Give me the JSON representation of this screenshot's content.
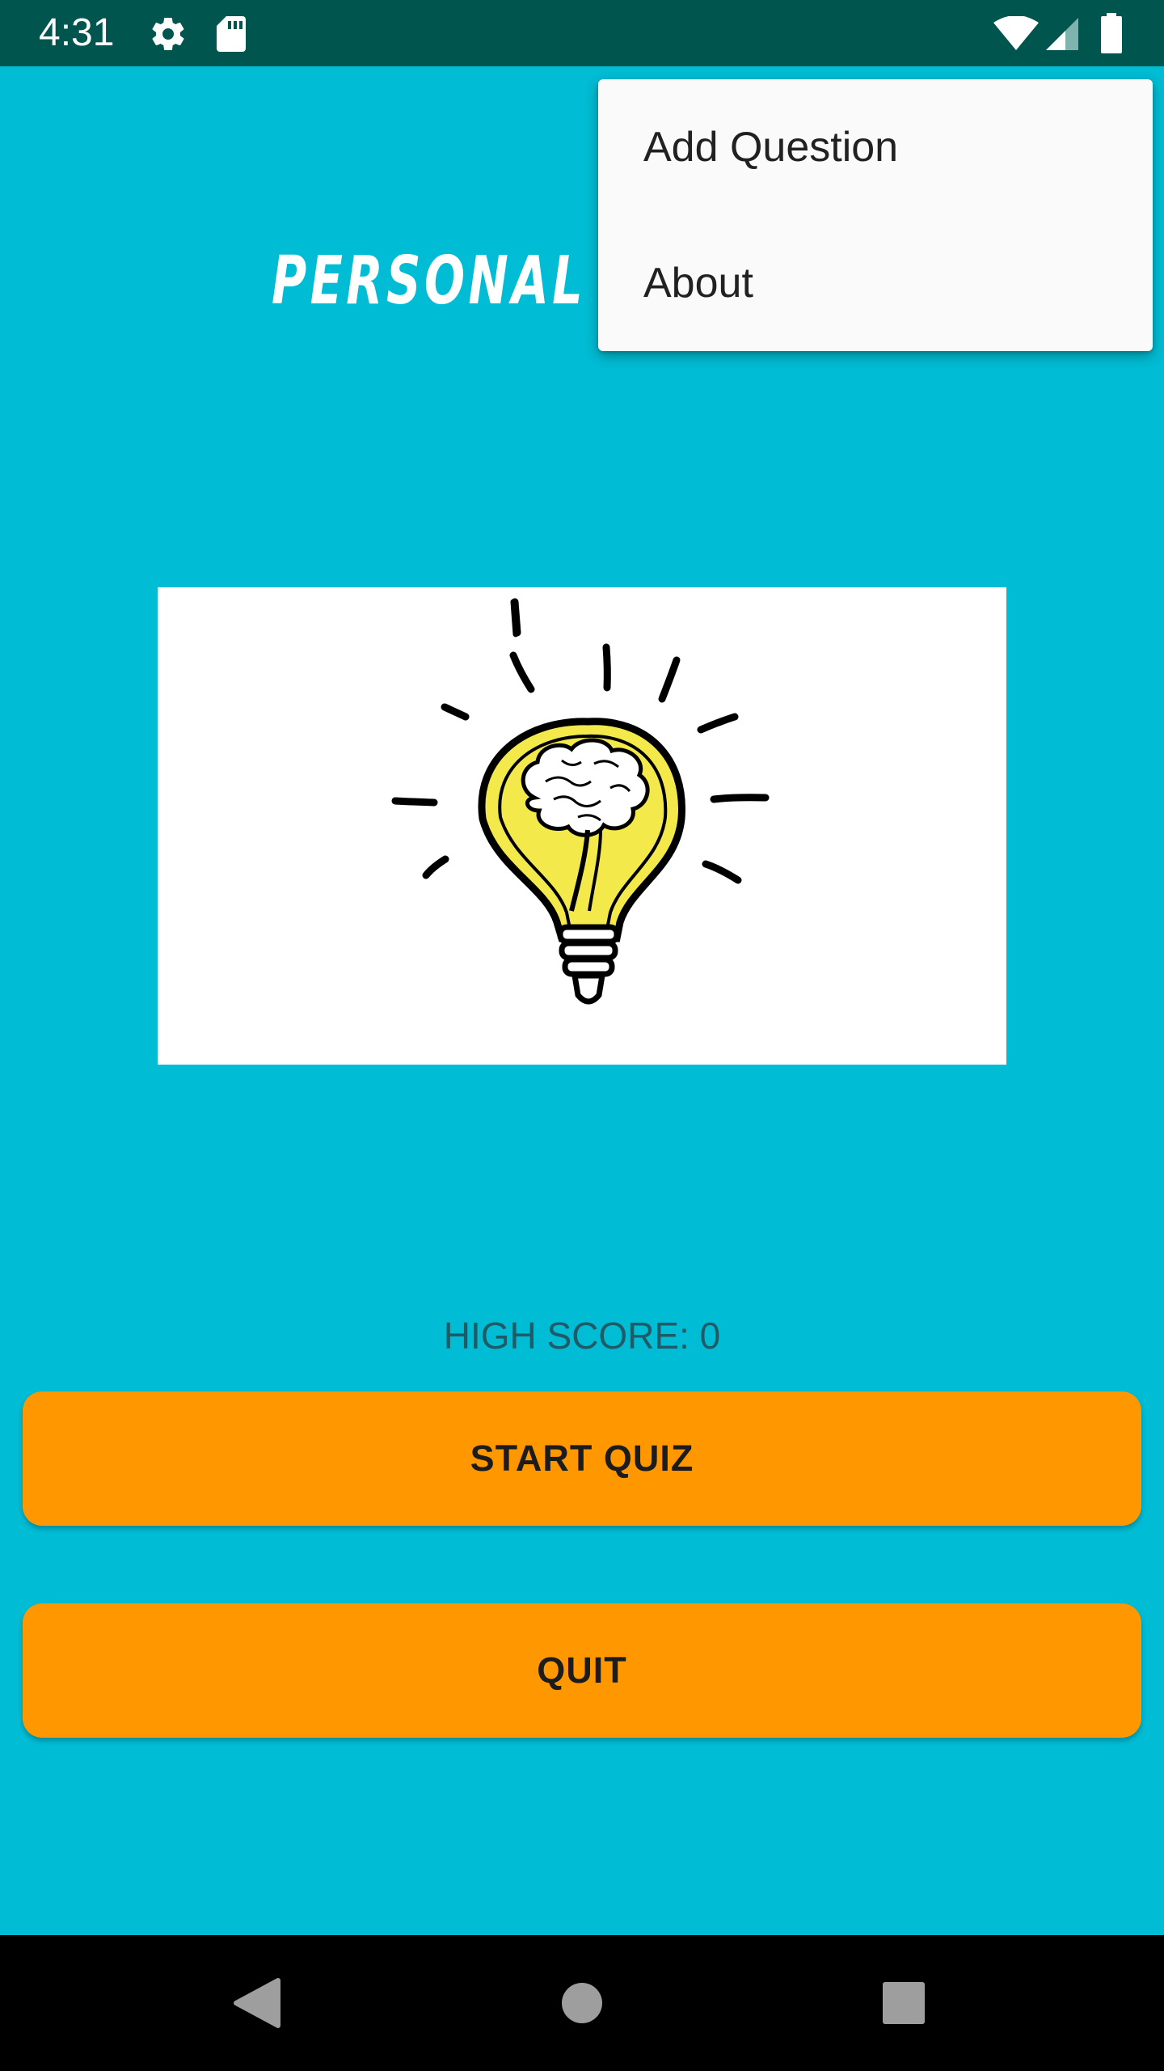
{
  "status_bar": {
    "time": "4:31",
    "icons": [
      "gear-icon",
      "sd-card-icon",
      "wifi-icon",
      "signal-icon",
      "battery-icon"
    ]
  },
  "app": {
    "title": "PERSONAL F",
    "image_icon": "lightbulb-brain-icon",
    "high_score_text": "HIGH SCORE: 0",
    "start_label": "START QUIZ",
    "quit_label": "QUIT"
  },
  "overflow_menu": {
    "items": [
      {
        "label": "Add Question"
      },
      {
        "label": "About"
      }
    ]
  },
  "nav_bar": {
    "buttons": [
      "back-icon",
      "home-icon",
      "recents-icon"
    ]
  },
  "colors": {
    "background": "#00bcd4",
    "status_bar": "#00564f",
    "button": "#ff9800",
    "menu": "#fafafa",
    "nav_bar": "#000000"
  }
}
